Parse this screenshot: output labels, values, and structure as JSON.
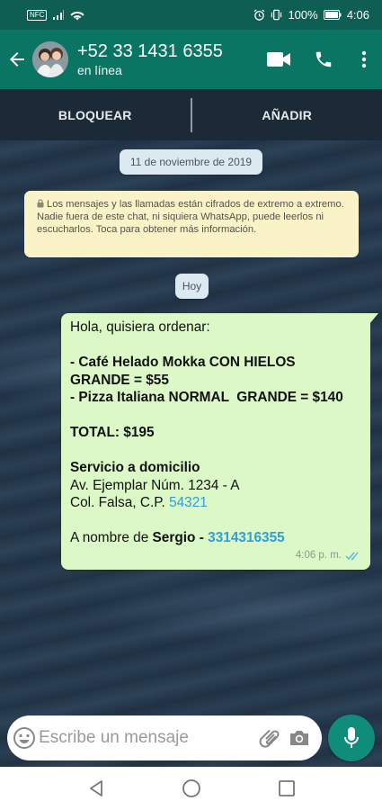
{
  "status_bar": {
    "nfc_label": "NFC",
    "battery": "100%",
    "time": "4:06"
  },
  "header": {
    "contact_name": "+52 33 1431 6355",
    "contact_status": "en línea"
  },
  "actions": {
    "block_label": "BLOQUEAR",
    "add_label": "AÑADIR"
  },
  "chat": {
    "date_chip": "11 de noviembre de 2019",
    "encryption_notice": "Los mensajes y las llamadas están cifrados de extremo a extremo. Nadie fuera de este chat, ni siquiera WhatsApp, puede leerlos ni escucharlos. Toca para obtener más información.",
    "today_chip": "Hoy",
    "message": {
      "greeting": "Hola, quisiera ordenar:",
      "item1": "- Café Helado Mokka CON HIELOS",
      "item1_cont": "GRANDE = $55",
      "item2": "- Pizza Italiana NORMAL  GRANDE = $140",
      "total": "TOTAL: $195",
      "delivery_title": "Servicio a domicilio",
      "address_line1": "Av. Ejemplar Núm. 1234 - A",
      "address_line2_prefix": "Col. Falsa, C.P. ",
      "postal_code": "54321",
      "name_prefix": "A nombre de ",
      "name": "Sergio",
      "name_sep": " - ",
      "phone": "3314316355",
      "time": "4:06 p. m."
    }
  },
  "composer": {
    "placeholder": "Escribe un mensaje"
  },
  "colors": {
    "header": "#0b7564",
    "status_bar": "#0e5e54",
    "bubble": "#dcf8c6",
    "mic_button": "#0f8d7a",
    "link": "#2e9fd8",
    "read_ticks": "#4fb6ec"
  },
  "icons": [
    "back-arrow-icon",
    "video-call-icon",
    "phone-icon",
    "more-vert-icon",
    "lock-icon",
    "double-check-icon",
    "emoji-icon",
    "attach-icon",
    "camera-icon",
    "mic-icon",
    "nav-back-icon",
    "nav-home-icon",
    "nav-recents-icon"
  ]
}
